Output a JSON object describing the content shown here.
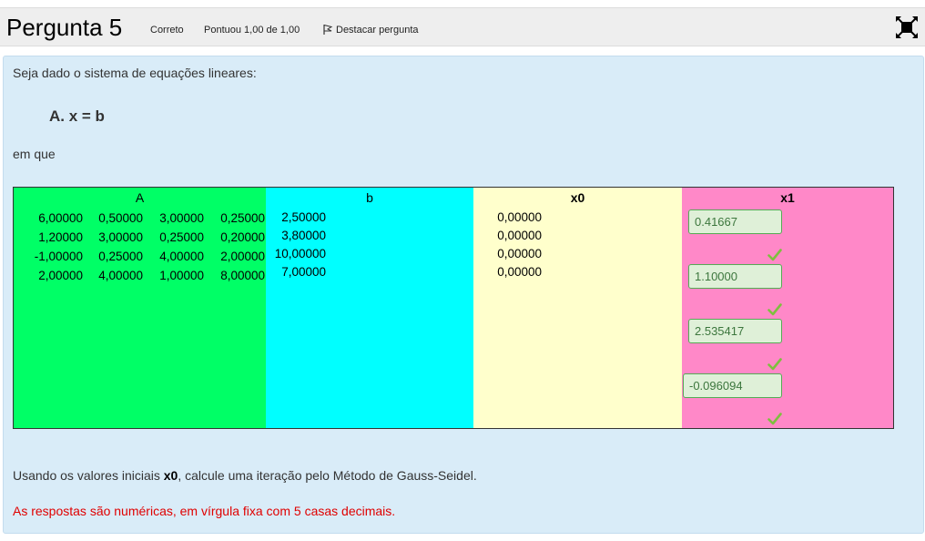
{
  "question": {
    "title": "Pergunta 5",
    "state": "Correto",
    "grade": "Pontuou 1,00 de 1,00",
    "flag_label": "Destacar pergunta"
  },
  "body": {
    "intro": "Seja dado o sistema de equações lineares:",
    "equation": "A. x = b",
    "em_que": "em que",
    "instruction_pre": "Usando os valores iniciais ",
    "instruction_bold": "x0",
    "instruction_post": ", calcule uma iteração pelo Método de Gauss-Seidel.",
    "warning": "As respostas são numéricas, em vírgula fixa com 5 casas decimais."
  },
  "table": {
    "headers": {
      "A": "A",
      "b": "b",
      "x0": "x0",
      "x1": "x1"
    },
    "A": [
      [
        "6,00000",
        "0,50000",
        "3,00000",
        "0,25000"
      ],
      [
        "1,20000",
        "3,00000",
        "0,25000",
        "0,20000"
      ],
      [
        "-1,00000",
        "0,25000",
        "4,00000",
        "2,00000"
      ],
      [
        "2,00000",
        "4,00000",
        "1,00000",
        "8,00000"
      ]
    ],
    "b": [
      "2,50000",
      "3,80000",
      "10,00000",
      "7,00000"
    ],
    "x0": [
      "0,00000",
      "0,00000",
      "0,00000",
      "0,00000"
    ],
    "x1_answers": [
      "0.41667",
      "1.10000",
      "2.535417",
      "-0.096094"
    ],
    "answer_status": "correct"
  },
  "colors": {
    "A_bg": "#00ff66",
    "b_bg": "#00ffff",
    "x0_bg": "#ffffcc",
    "x1_bg": "#ff88c8",
    "correct_bg": "#dff0d8",
    "check": "#7fbf3f",
    "warning": "#e00000"
  }
}
